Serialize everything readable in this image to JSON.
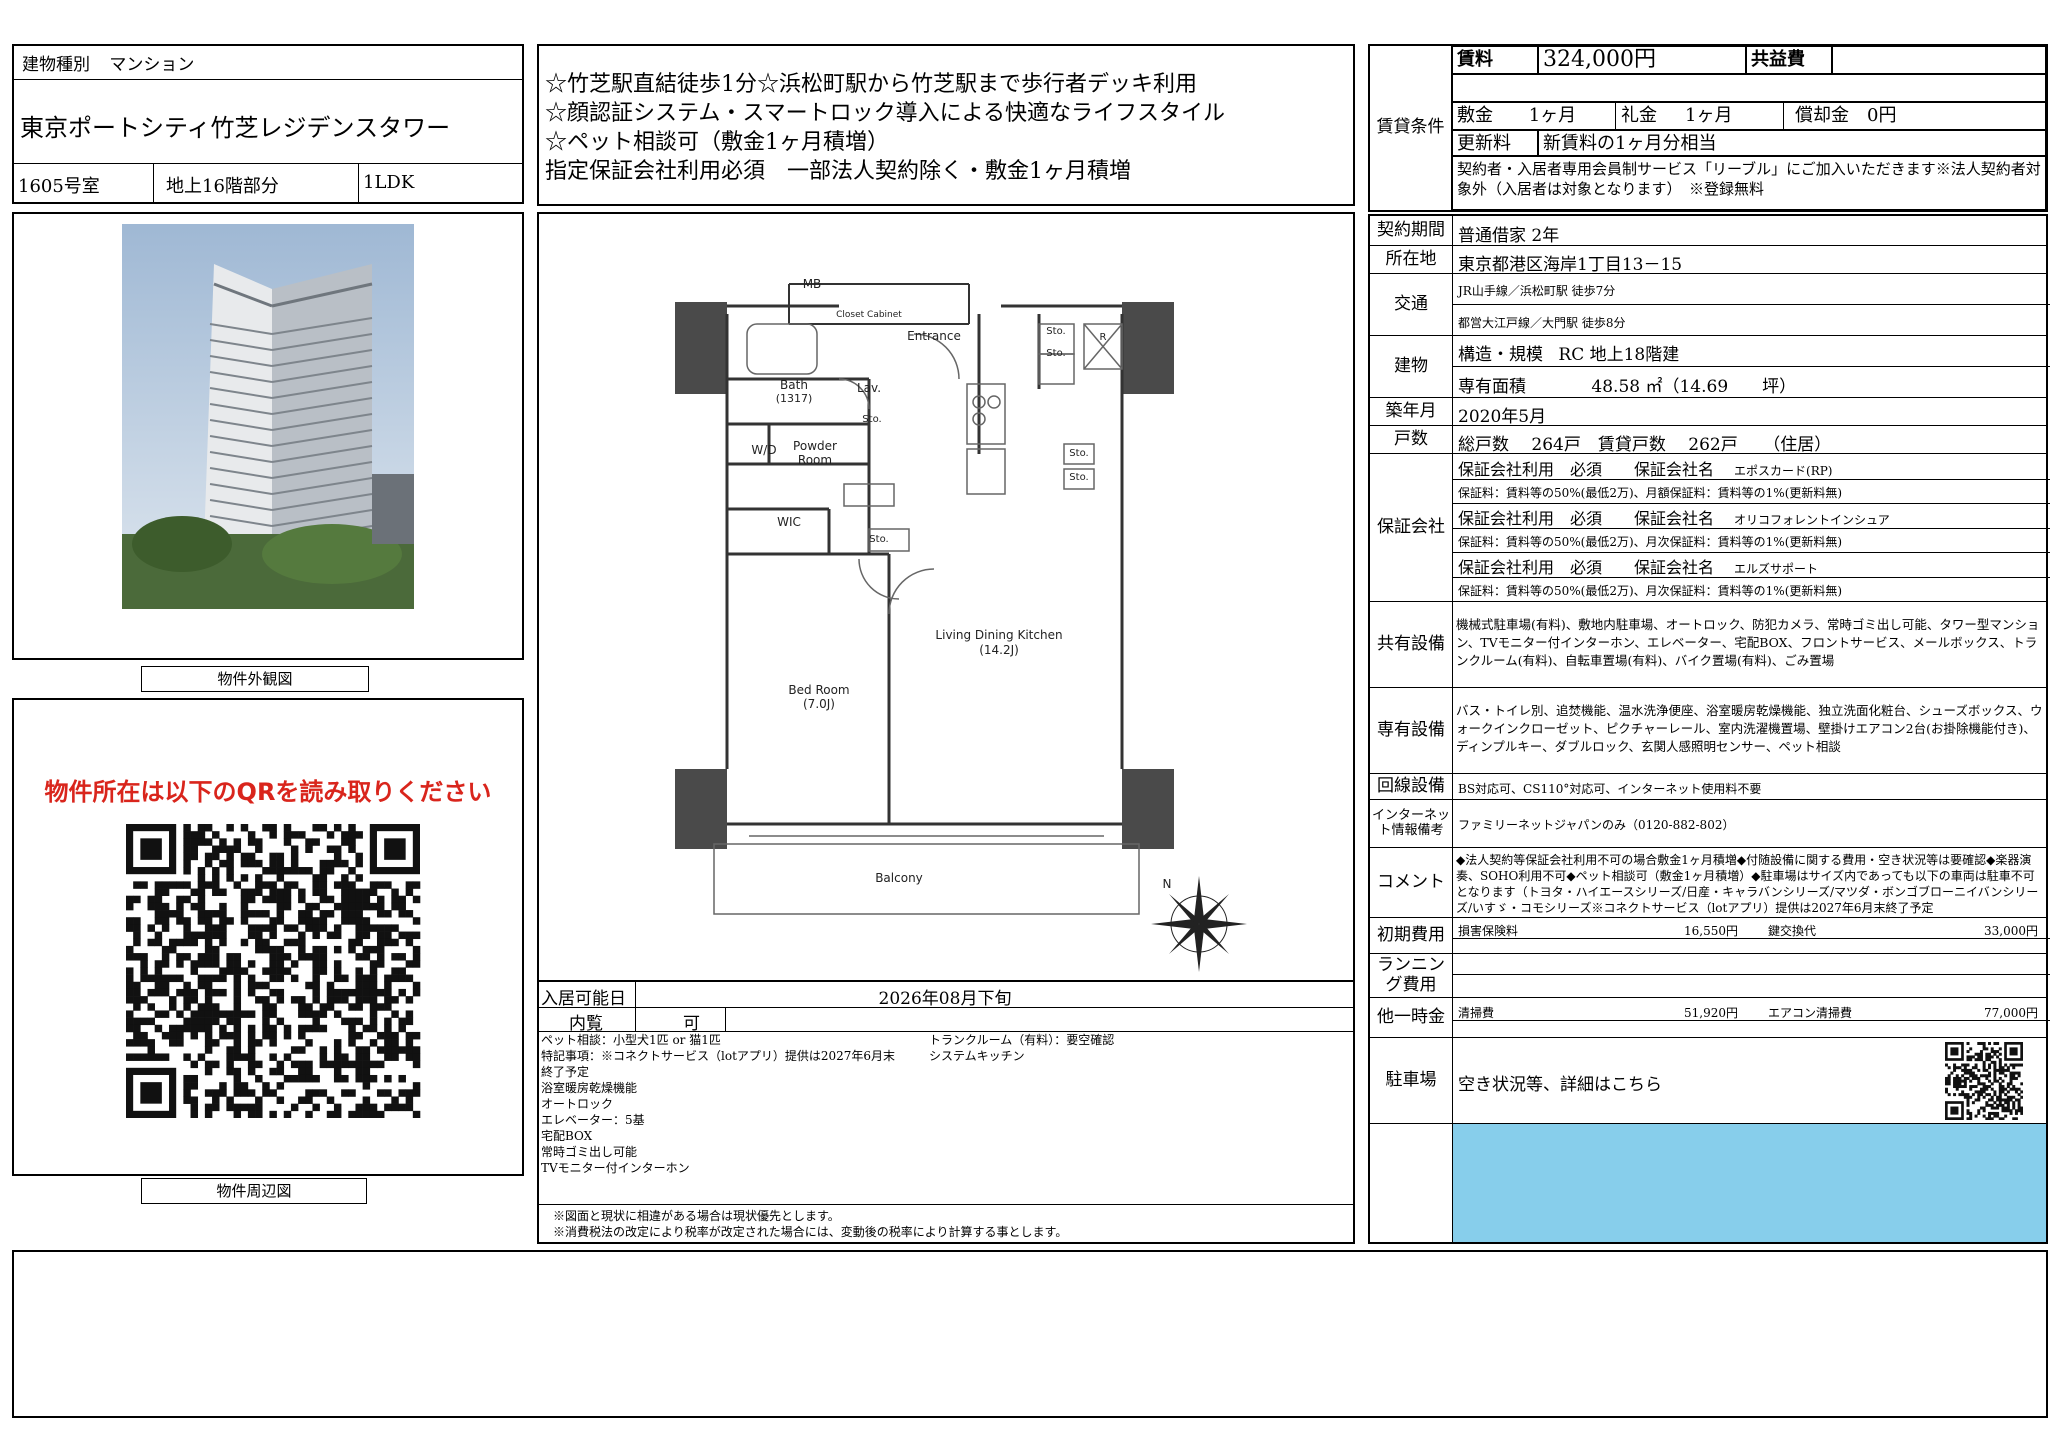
{
  "header": {
    "building_type_label": "建物種別",
    "building_type": "マンション",
    "building_name": "東京ポートシティ竹芝レジデンスタワー",
    "room": "1605号室",
    "floor": "地上16階部分",
    "layout": "1LDK"
  },
  "highlights": [
    "☆竹芝駅直結徒歩1分☆浜松町駅から竹芝駅まで歩行者デッキ利用",
    "☆顔認証システム・スマートロック導入による快適なライフスタイル",
    "☆ペット相談可（敷金1ヶ月積増）",
    "指定保証会社利用必須　一部法人契約除く・敷金1ヶ月積増"
  ],
  "exterior_caption": "物件外観図",
  "surroundings_caption": "物件周辺図",
  "qr_notice": "物件所在は以下のQRを読み取りください",
  "floorplan": {
    "labels": {
      "mb": "MB",
      "closet": "Closet Cabinet",
      "entrance": "Entrance",
      "sto1": "Sto.",
      "sto2": "Sto.",
      "r": "R",
      "bath": "Bath",
      "bath_size": "(1317)",
      "lav": "Lav.",
      "sto3": "Sto.",
      "wd": "W/D",
      "powder": "Powder",
      "powder2": "Room",
      "sto4": "Sto.",
      "sto5": "Sto.",
      "wic": "WIC",
      "sto6": "Sto.",
      "ldk": "Living Dining Kitchen",
      "ldk_size": "(14.2J)",
      "bed": "Bed Room",
      "bed_size": "(7.0J)",
      "balcony": "Balcony",
      "north": "N"
    }
  },
  "move_in": {
    "label": "入居可能日",
    "value": "2026年08月下旬",
    "viewing_label": "内覧",
    "viewing_value": "可"
  },
  "notes_left": [
    "ペット相談：小型犬1匹 or 猫1匹",
    "特記事項：※コネクトサービス（lotアプリ）提供は2027年6月末",
    "終了予定",
    "浴室暖房乾燥機能",
    "オートロック",
    "エレベーター：5基",
    "宅配BOX",
    "常時ゴミ出し可能",
    "TVモニター付インターホン"
  ],
  "notes_right": [
    "トランクルーム（有料）：要空確認",
    "システムキッチン"
  ],
  "disclaimers": [
    "※図面と現状に相違がある場合は現状優先とします。",
    "※消費税法の改定により税率が改定された場合には、変動後の税率により計算する事とします。"
  ],
  "rent": {
    "section_label": "賃貸条件",
    "rent_label": "賃料",
    "rent_value": "324,000円",
    "common_label": "共益費",
    "common_value": "",
    "deposit_label": "敷金",
    "deposit_value": "1ヶ月",
    "key_label": "礼金",
    "key_value": "1ヶ月",
    "amort_label": "償却金",
    "amort_value": "0円",
    "renewal_label": "更新料",
    "renewal_value": "新賃料の1ヶ月分相当",
    "note": "契約者・入居者専用会員制サービス「リーブル」にご加入いただきます※法人契約者対象外（入居者は対象となります）　※登録無料"
  },
  "details": {
    "contract_label": "契約期間",
    "contract_value": "普通借家 2年",
    "address_label": "所在地",
    "address_value": "東京都港区海岸1丁目13－15",
    "transit_label": "交通",
    "transit1": "JR山手線／浜松町駅 徒歩7分",
    "transit2": "都営大江戸線／大門駅 徒歩8分",
    "building_label": "建物",
    "structure_label": "構造・規模",
    "structure_value": "RC 地上18階建",
    "area_label": "専有面積",
    "area_value": "48.58 ㎡（14.69　　坪）",
    "built_label": "築年月",
    "built_value": "2020年5月",
    "units_label": "戸数",
    "units_value": "総戸数　 264戸　賃貸戸数　 262戸　　（住居）",
    "guarantor_label": "保証会社",
    "guarantors": [
      {
        "head": "保証会社利用　必須　　保証会社名",
        "name": "エポスカード(RP)",
        "fee": "保証料：賃料等の50%(最低2万)、月額保証料：賃料等の1%(更新料無)"
      },
      {
        "head": "保証会社利用　必須　　保証会社名",
        "name": "オリコフォレントインシュア",
        "fee": "保証料：賃料等の50%(最低2万)、月次保証料：賃料等の1%(更新料無)"
      },
      {
        "head": "保証会社利用　必須　　保証会社名",
        "name": "エルズサポート",
        "fee": "保証料：賃料等の50%(最低2万)、月次保証料：賃料等の1%(更新料無)"
      }
    ],
    "shared_label": "共有設備",
    "shared_value": "機械式駐車場(有料)、敷地内駐車場、オートロック、防犯カメラ、常時ゴミ出し可能、タワー型マンション、TVモニター付インターホン、エレベーター、宅配BOX、フロントサービス、メールボックス、トランクルーム(有料)、自転車置場(有料)、バイク置場(有料)、ごみ置場",
    "private_label": "専有設備",
    "private_value": "バス・トイレ別、追焚機能、温水洗浄便座、浴室暖房乾燥機能、独立洗面化粧台、シューズボックス、ウォークインクローゼット、ピクチャーレール、室内洗濯機置場、壁掛けエアコン2台(お掛除機能付き)、ディンプルキー、ダブルロック、玄関人感照明センサー、ペット相談",
    "line_label": "回線設備",
    "line_value": "BS対応可、CS110°対応可、インターネット使用料不要",
    "internet_label": "インターネット情報備考",
    "internet_value": "ファミリーネットジャパンのみ（0120-882-802）",
    "comment_label": "コメント",
    "comment_value": "◆法人契約等保証会社利用不可の場合敷金1ヶ月積増◆付随設備に関する費用・空き状況等は要確認◆楽器演奏、SOHO利用不可◆ペット相談可（敷金1ヶ月積増）◆駐車場はサイズ内であっても以下の車両は駐車不可となります（トヨタ・ハイエースシリーズ/日産・キャラバンシリーズ/マツダ・ボンゴブローニイバンシリーズ/いすゞ・コモシリーズ※コネクトサービス（lotアプリ）提供は2027年6月末終了予定",
    "initial_label": "初期費用",
    "initial_items": [
      {
        "name": "損害保険料",
        "value": "16,550円"
      },
      {
        "name": "鍵交換代",
        "value": "33,000円"
      }
    ],
    "running_label": "ランニング費用",
    "onetime_label": "他一時金",
    "onetime_items": [
      {
        "name": "清掃費",
        "value": "51,920円"
      },
      {
        "name": "エアコン清掃費",
        "value": "77,000円"
      }
    ],
    "parking_label": "駐車場",
    "parking_value": "空き状況等、詳細はこちら"
  },
  "colors": {
    "accent_blue": "#87ceeb",
    "qr_red": "#d9251c"
  }
}
